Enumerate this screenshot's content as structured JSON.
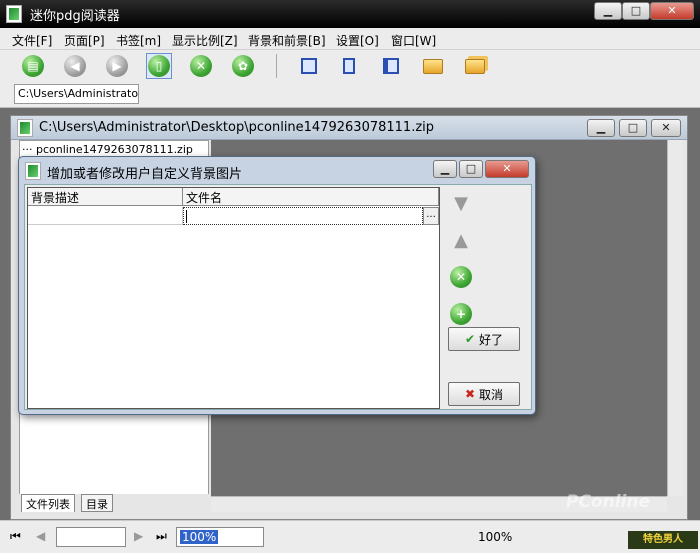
{
  "window": {
    "title": "迷你pdg阅读器",
    "min": "▁",
    "max": "□",
    "close": "✕"
  },
  "menu": [
    "文件[F]",
    "页面[P]",
    "书签[m]",
    "显示比例[Z]",
    "背景和前景[B]",
    "设置[O]",
    "窗口[W]"
  ],
  "toolbar": {
    "icons": [
      "open-folder-icon",
      "back-icon",
      "forward-icon",
      "view-panel-icon",
      "stop-icon",
      "settings-icon",
      "multi-page-icon",
      "single-page-icon",
      "two-page-icon",
      "folder-icon",
      "folders-icon"
    ]
  },
  "path_tab": "C:\\Users\\Administrator\\D",
  "document": {
    "title": "C:\\Users\\Administrator\\Desktop\\pconline1479263078111.zip",
    "tree_item": "pconline1479263078111.zip",
    "tabs": [
      "文件列表",
      "目录"
    ]
  },
  "dialog": {
    "title": "增加或者修改用户自定义背景图片",
    "columns": [
      "背景描述",
      "文件名"
    ],
    "ellipsis": "...",
    "ok": "好了",
    "cancel": "取消"
  },
  "status": {
    "zoom_select": "100%",
    "zoom_text": "100%"
  },
  "watermark": {
    "brand": "PConline",
    "badge": "特色男人"
  },
  "colors": {
    "accent": "#2a9a2a",
    "titlebar": "#111111",
    "dialog": "#c7d3e3"
  }
}
